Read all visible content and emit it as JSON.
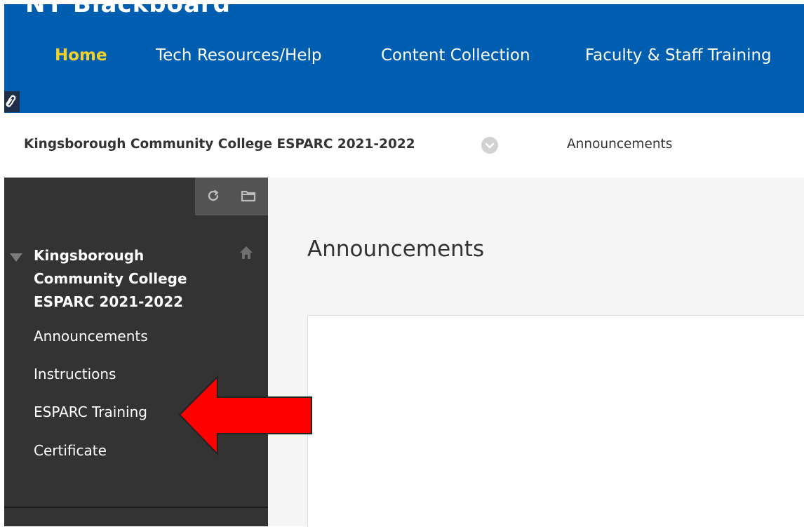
{
  "header": {
    "logo_text": "NY Blackboard",
    "nav": [
      {
        "label": "Home",
        "active": true
      },
      {
        "label": "Tech Resources/Help",
        "active": false
      },
      {
        "label": "Content Collection",
        "active": false
      },
      {
        "label": "Faculty & Staff Training",
        "active": false
      }
    ]
  },
  "breadcrumb": {
    "course": "Kingsborough Community College ESPARC 2021-2022",
    "page": "Announcements"
  },
  "sidebar": {
    "course_title": "Kingsborough Community College ESPARC 2021-2022",
    "items": [
      {
        "label": "Announcements"
      },
      {
        "label": "Instructions"
      },
      {
        "label": "ESPARC Training"
      },
      {
        "label": "Certificate"
      }
    ]
  },
  "content": {
    "title": "Announcements"
  },
  "colors": {
    "header_blue": "#005eb0",
    "active_nav": "#f5d22b",
    "sidebar_bg": "#333333",
    "arrow_red": "#ff0000"
  }
}
